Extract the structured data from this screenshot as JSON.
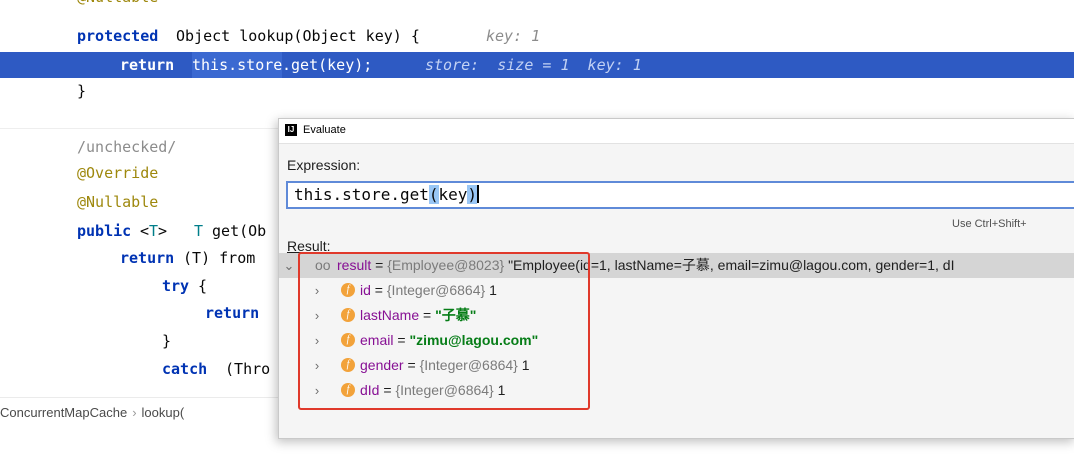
{
  "editor": {
    "line0": "@Nullable",
    "line1": {
      "kw": "protected",
      "text": " Object lookup(Object key) {",
      "hint": "key: 1"
    },
    "line2": {
      "kw": "return",
      "pre": " ",
      "thisstore": "this.store",
      "rest": ".get(key);",
      "hint": "store:  size = 1  key: 1"
    },
    "line3": "}",
    "line4": "/unchecked/",
    "line5": "@Override",
    "line6": "@Nullable",
    "line7": {
      "kw": "public",
      "lt": " <",
      "tp": "T",
      "gt": "> ",
      "tp2": "T",
      "text": " get(Ob"
    },
    "line8": {
      "kw": "return",
      "text": " (T) from"
    },
    "line9": {
      "kw": "try",
      "text": " {"
    },
    "line10": {
      "kw": "return"
    },
    "line11": "}",
    "line12": {
      "kw": "catch",
      "text": " (Thro"
    }
  },
  "breadcrumb": {
    "class": "ConcurrentMapCache",
    "method": "lookup("
  },
  "dialog": {
    "title": "Evaluate",
    "app_icon": "IJ",
    "expression_label": "Expression:",
    "expression": {
      "pre": "this.store.get",
      "open": "(",
      "arg": "key",
      "close": ")"
    },
    "hint": "Use Ctrl+Shift+",
    "result_label": "Result:",
    "result": {
      "name": "result",
      "ref": "{Employee@8023}",
      "value": "\"Employee(id=1, lastName=子慕, email=zimu@lagou.com, gender=1, dI",
      "children": [
        {
          "name": "id",
          "ref": "{Integer@6864}",
          "value": "1"
        },
        {
          "name": "lastName",
          "string": "\"子慕\""
        },
        {
          "name": "email",
          "string": "\"zimu@lagou.com\""
        },
        {
          "name": "gender",
          "ref": "{Integer@6864}",
          "value": "1"
        },
        {
          "name": "dId",
          "ref": "{Integer@6864}",
          "value": "1"
        }
      ]
    }
  },
  "icons": {
    "expand": "chevron-right-icon",
    "collapse": "chevron-down-icon",
    "field": "field-icon",
    "object": "object-icon"
  },
  "colors": {
    "selection": "#2e5ac3",
    "keyword": "#0033b3",
    "string": "#067d17",
    "field": "#871094",
    "highlight_box": "#e0392b"
  }
}
